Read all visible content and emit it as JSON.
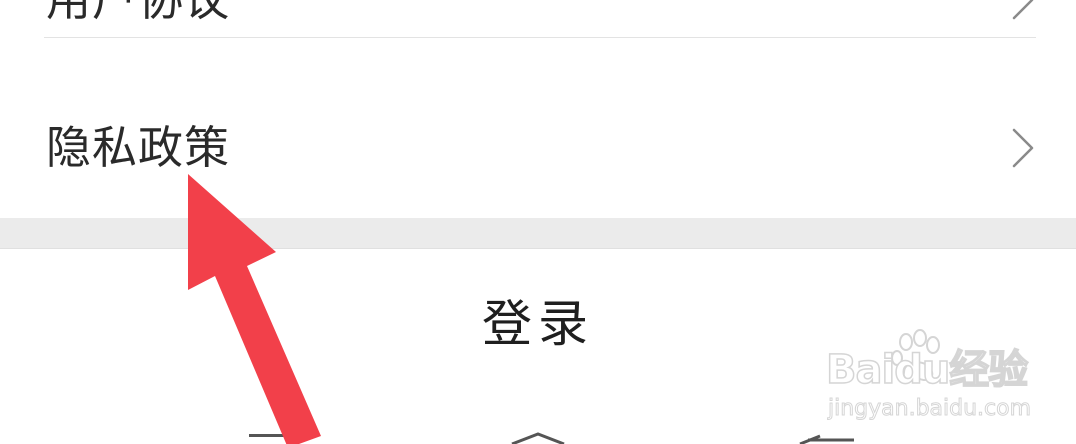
{
  "menu": {
    "items": [
      {
        "label": "用户协议"
      },
      {
        "label": "隐私政策"
      }
    ]
  },
  "login": {
    "label": "登录"
  },
  "watermark": {
    "brand": "Baidu经验",
    "url": "jingyan.baidu.com"
  },
  "annotation": {
    "arrow_color": "#f2404a"
  },
  "icons": {
    "chevron": "chevron-right-icon",
    "nav_menu": "menu-icon",
    "nav_home": "home-icon",
    "nav_back": "back-icon"
  }
}
